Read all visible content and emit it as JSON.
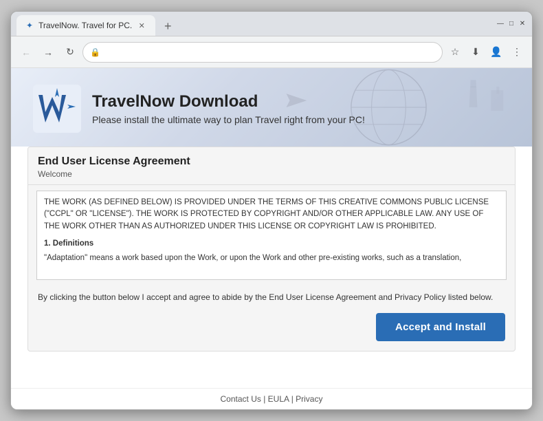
{
  "browser": {
    "tab_title": "TravelNow. Travel for PC.",
    "new_tab_label": "+",
    "back_icon": "←",
    "forward_icon": "→",
    "refresh_icon": "↻",
    "lock_icon": "🔒",
    "address": "",
    "star_icon": "☆",
    "profile_icon": "👤",
    "menu_icon": "⋮",
    "minimize_icon": "—",
    "maximize_icon": "□",
    "close_icon": "✕",
    "close_tab_icon": "✕",
    "download_icon": "⬇"
  },
  "hero": {
    "title": "TravelNow Download",
    "subtitle": "Please install the ultimate way to plan Travel right from your PC!"
  },
  "eula": {
    "section_title": "End User License Agreement",
    "welcome_label": "Welcome",
    "body_text_1": "THE WORK (AS DEFINED BELOW) IS PROVIDED UNDER THE TERMS OF THIS CREATIVE COMMONS PUBLIC LICENSE (\"CCPL\" OR \"LICENSE\"). THE WORK IS PROTECTED BY COPYRIGHT AND/OR OTHER APPLICABLE LAW. ANY USE OF THE WORK OTHER THAN AS AUTHORIZED UNDER THIS LICENSE OR COPYRIGHT LAW IS PROHIBITED.",
    "definitions_header": "1. Definitions",
    "definitions_text": "\"Adaptation\" means a work based upon the Work, or upon the Work and other pre-existing works, such as a translation,",
    "agreement_text": "By clicking the button below I accept and agree to abide by the End User License Agreement and Privacy Policy listed below.",
    "accept_button": "Accept and Install"
  },
  "footer": {
    "links": [
      "Contact Us",
      "EULA",
      "Privacy"
    ],
    "separator": " | "
  }
}
